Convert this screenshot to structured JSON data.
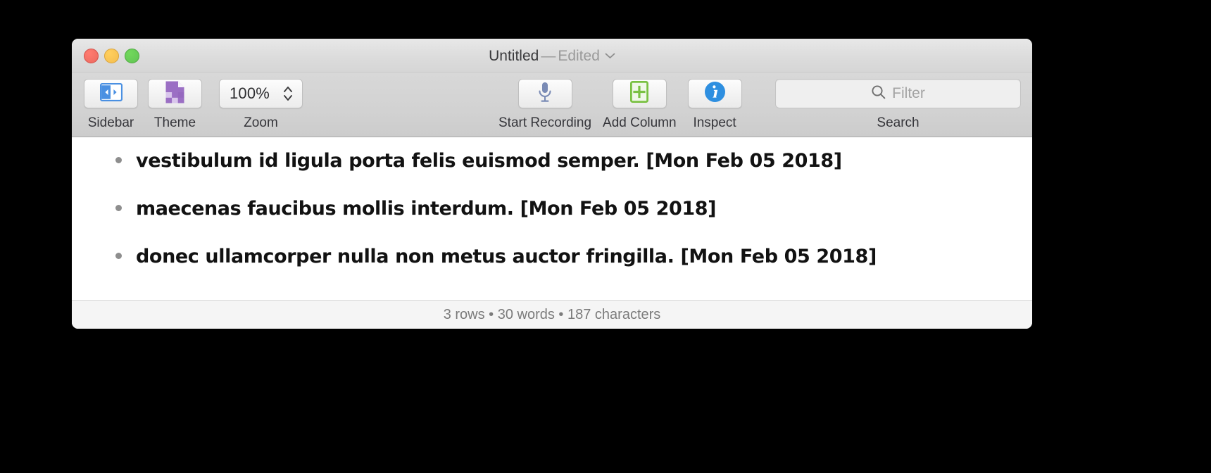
{
  "window": {
    "title_name": "Untitled",
    "title_separator": "—",
    "title_state": "Edited",
    "chevron_icon": "chevron-down-icon",
    "traffic_lights": [
      {
        "name": "close-button",
        "color": "#ec6a5f"
      },
      {
        "name": "minimize-button",
        "color": "#f4bd4f"
      },
      {
        "name": "maximize-button",
        "color": "#61c454"
      }
    ]
  },
  "toolbar": {
    "sidebar": {
      "label": "Sidebar",
      "icon": "sidebar-toggle-icon",
      "color": "#4a90e2"
    },
    "theme": {
      "label": "Theme",
      "icon": "theme-document-icon",
      "color": "#9b6fc4"
    },
    "zoom": {
      "label": "Zoom",
      "value": "100%",
      "icon": "stepper-icon"
    },
    "record": {
      "label": "Start Recording",
      "icon": "microphone-icon",
      "color": "#7a8bb5"
    },
    "add_column": {
      "label": "Add Column",
      "icon": "add-column-icon",
      "color": "#7ac143"
    },
    "inspect": {
      "label": "Inspect",
      "icon": "info-circle-icon",
      "color": "#2e8fe0"
    },
    "search": {
      "label": "Search",
      "placeholder": "Filter",
      "value": "",
      "icon": "search-icon"
    }
  },
  "document": {
    "rows": [
      {
        "bullet": "•",
        "text": "vestibulum id ligula porta felis euismod semper. [Mon Feb 05 2018]"
      },
      {
        "bullet": "•",
        "text": "maecenas faucibus mollis interdum. [Mon Feb 05 2018]"
      },
      {
        "bullet": "•",
        "text": "donec ullamcorper nulla non metus auctor fringilla. [Mon Feb 05 2018]"
      }
    ]
  },
  "statusbar": {
    "text": "3 rows • 30 words • 187 characters",
    "rows": "3 rows",
    "words": "30 words",
    "characters": "187 characters"
  }
}
